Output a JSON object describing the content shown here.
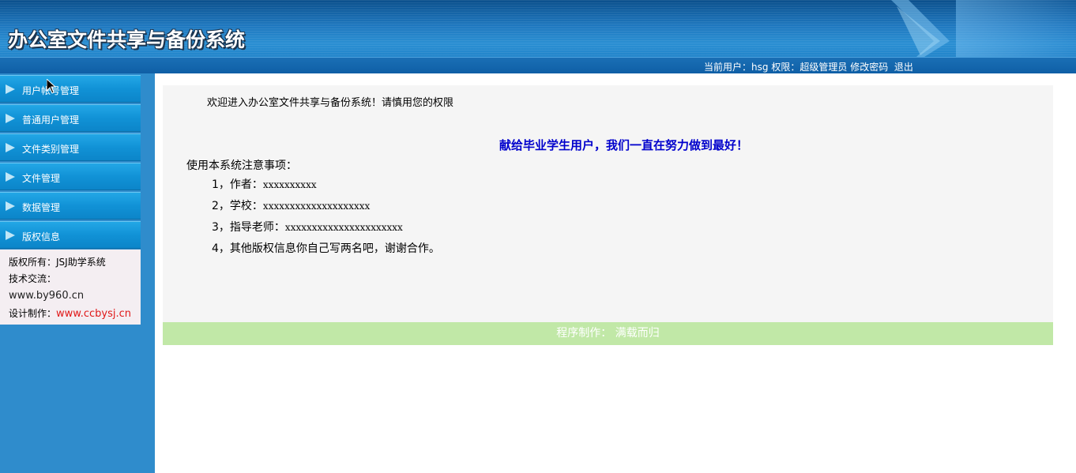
{
  "header": {
    "title": "办公室文件共享与备份系统",
    "current_user_label": "当前用户：",
    "current_user": "hsg",
    "permission_label": "权限：",
    "permission": "超级管理员",
    "change_password": "修改密码",
    "logout": "退出"
  },
  "sidebar": {
    "items": [
      {
        "label": "用户帐号管理"
      },
      {
        "label": "普通用户管理"
      },
      {
        "label": "文件类别管理"
      },
      {
        "label": "文件管理"
      },
      {
        "label": "数据管理"
      },
      {
        "label": "版权信息"
      }
    ],
    "info": {
      "copyright": "版权所有：JSJ助学系统",
      "tech": "技术交流：",
      "site": "www.by960.cn",
      "design_label": "设计制作：",
      "design_site": "www.ccbysj.cn"
    }
  },
  "main": {
    "welcome": "欢迎进入办公室文件共享与备份系统！请慎用您的权限",
    "slogan": "献给毕业学生用户，我们一直在努力做到最好！",
    "notice_title": "使用本系统注意事项：",
    "notices": [
      {
        "prefix": "1，作者：",
        "value": "xxxxxxxxxx"
      },
      {
        "prefix": "2，学校：",
        "value": "xxxxxxxxxxxxxxxxxxxx"
      },
      {
        "prefix": "3，指导老师：",
        "value": "xxxxxxxxxxxxxxxxxxxxxx"
      },
      {
        "prefix": "4，其他版权信息你自己写两名吧，谢谢合作。",
        "value": ""
      }
    ],
    "footer": "程序制作：  满载而归"
  },
  "colors": {
    "header_blue": "#1f78bf",
    "sidebar_blue": "#2f8ccc",
    "menu_blue": "#1192d6",
    "slogan_blue": "#0000cc",
    "footer_green": "#c1e8a7",
    "link_red": "#e01818"
  }
}
